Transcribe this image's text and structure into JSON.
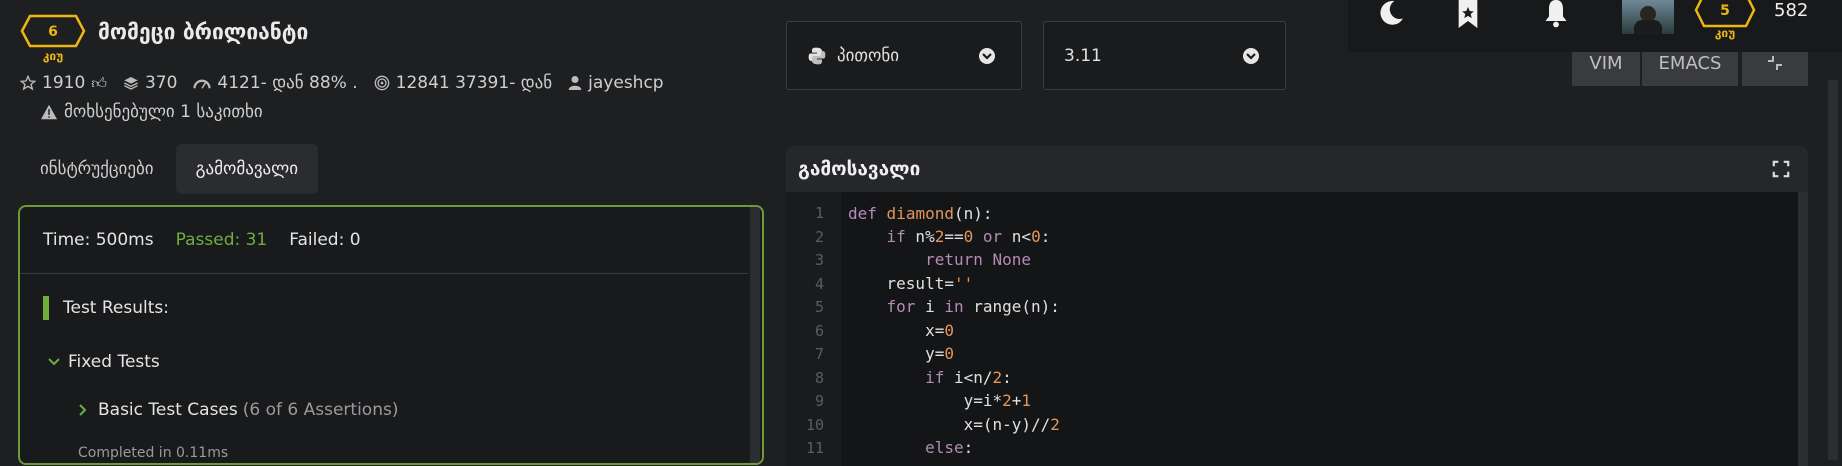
{
  "kata": {
    "rank_number": "6",
    "rank_label": "კიუ",
    "title": "მომეცი ბრილიანტი",
    "stars": "1910",
    "collections": "370",
    "completed": "4121- დან 88% .",
    "attempts": "12841 37391- დან",
    "author": "jayeshcp",
    "issues": "მოხსენებული 1 საკითხი"
  },
  "tabs": [
    "ინსტრუქციები",
    "გამომავალი"
  ],
  "language": {
    "value": "პითონი"
  },
  "version": {
    "value": "3.11"
  },
  "editor_modes": [
    "VIM",
    "EMACS"
  ],
  "user": {
    "rank_number": "5",
    "rank_label": "კიუ",
    "honor": "582"
  },
  "results": {
    "time": "Time: 500ms",
    "passed": "Passed: 31",
    "failed": "Failed: 0",
    "heading": "Test Results:",
    "group": "Fixed Tests",
    "case": "Basic Test Cases",
    "case_detail": "(6 of 6 Assertions)",
    "completed": "Completed in 0.11ms"
  },
  "output_title": "გამოსავალი",
  "code_lines": [
    "1",
    "2",
    "3",
    "4",
    "5",
    "6",
    "7",
    "8",
    "9",
    "10",
    "11"
  ],
  "colors": {
    "accent_green": "#6f9a3a",
    "rank_yellow": "#ecb613",
    "passed_text": "#6fae3e"
  },
  "icons": [
    "star-icon",
    "layers-icon",
    "gauge-icon",
    "target-icon",
    "user-icon",
    "warning-icon",
    "moon-icon",
    "bookmark-icon",
    "bell-icon",
    "python-icon",
    "expand-icon",
    "collapse-icon",
    "chevron-down-icon",
    "chevron-right-icon"
  ]
}
